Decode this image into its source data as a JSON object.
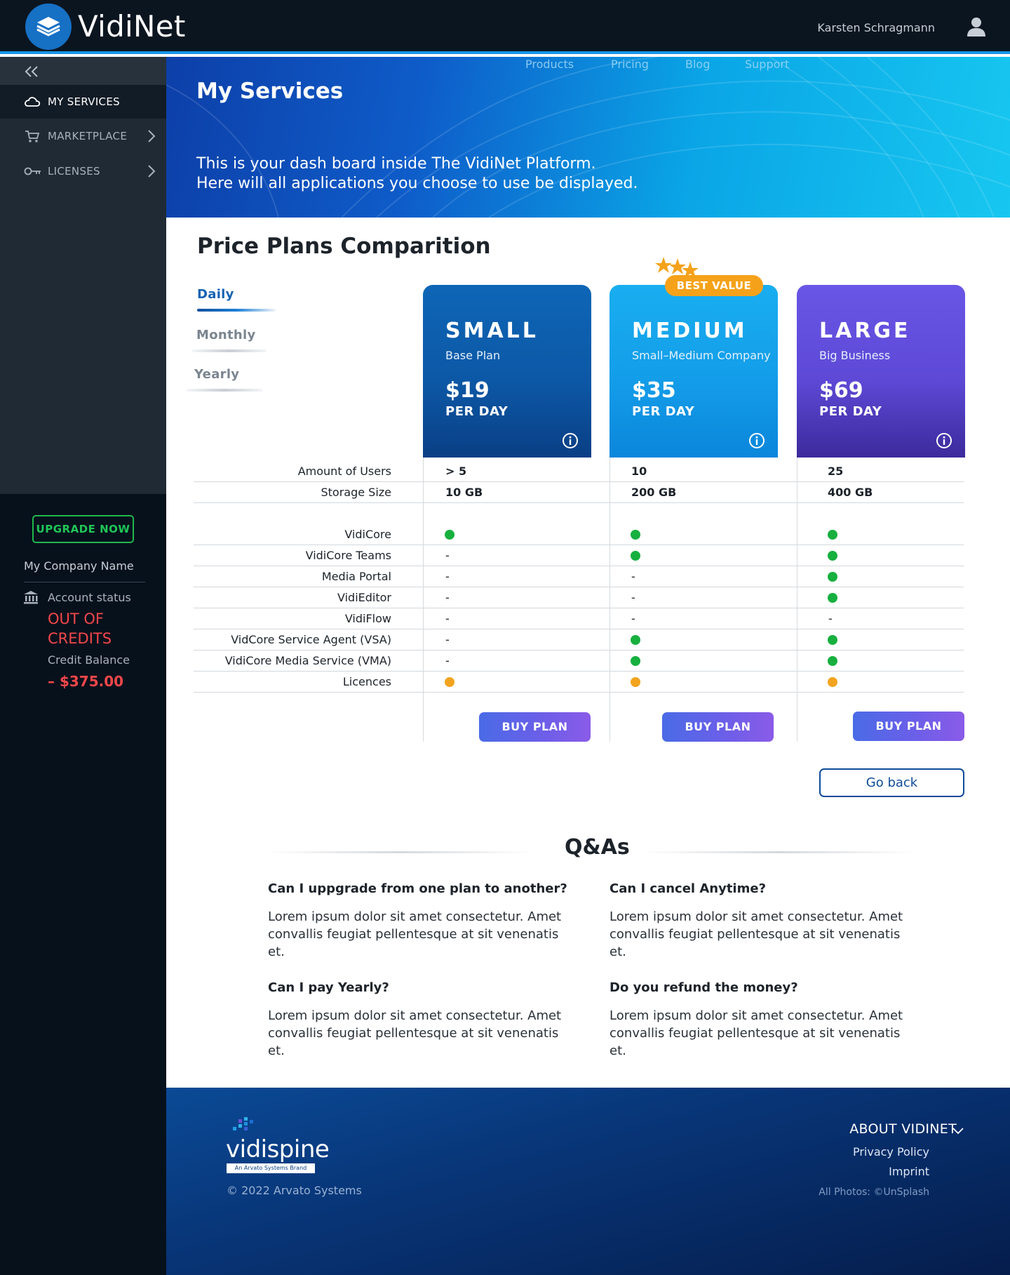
{
  "app": {
    "name": "VidiNet",
    "user_name": "Karsten Schragmann"
  },
  "sidebar": {
    "items": [
      {
        "label": "MY SERVICES",
        "icon": "cloud-icon",
        "active": true
      },
      {
        "label": "MARKETPLACE",
        "icon": "cart-icon"
      },
      {
        "label": "LICENSES",
        "icon": "key-icon"
      }
    ],
    "upgrade_label": "UPGRADE NOW",
    "company_name": "My Company Name",
    "account_status_label": "Account status",
    "account_status_value": "OUT OF CREDITS",
    "credit_balance_label": "Credit Balance",
    "credit_balance_value": "– $375.00"
  },
  "hero": {
    "nav": [
      "Products",
      "Pricing",
      "Blog",
      "Support"
    ],
    "title": "My Services",
    "subtitle_line1": "This is your dash board inside The VidiNet Platform.",
    "subtitle_line2": "Here will all applications you choose to use be displayed."
  },
  "pricing": {
    "title": "Price Plans Comparition",
    "periods": [
      "Daily",
      "Monthly",
      "Yearly"
    ],
    "active_period": "Daily",
    "best_value_label": "BEST VALUE",
    "plans": [
      {
        "name": "SMALL",
        "subtitle": "Base Plan",
        "price": "$19",
        "period": "PER DAY",
        "users": "> 5",
        "storage": "10 GB"
      },
      {
        "name": "MEDIUM",
        "subtitle": "Small–Medium Company",
        "price": "$35",
        "period": "PER DAY",
        "users": "10",
        "storage": "200 GB"
      },
      {
        "name": "LARGE",
        "subtitle": "Big Business",
        "price": "$69",
        "period": "PER DAY",
        "users": "25",
        "storage": "400 GB"
      }
    ],
    "row_labels": {
      "users": "Amount of Users",
      "storage": "Storage Size"
    },
    "features": [
      {
        "label": "VidiCore",
        "values": [
          "green",
          "green",
          "green"
        ]
      },
      {
        "label": "VidiCore Teams",
        "values": [
          "-",
          "green",
          "green"
        ]
      },
      {
        "label": "Media Portal",
        "values": [
          "-",
          "-",
          "green"
        ]
      },
      {
        "label": "VidiEditor",
        "values": [
          "-",
          "-",
          "green"
        ]
      },
      {
        "label": "VidiFlow",
        "values": [
          "-",
          "-",
          "-"
        ]
      },
      {
        "label": "VidCore Service Agent (VSA)",
        "values": [
          "-",
          "green",
          "green"
        ]
      },
      {
        "label": "VidiCore Media Service (VMA)",
        "values": [
          "-",
          "green",
          "green"
        ]
      },
      {
        "label": "Licences",
        "values": [
          "orange",
          "orange",
          "orange"
        ]
      }
    ],
    "buy_label": "BUY PLAN",
    "go_back_label": "Go back"
  },
  "qa": {
    "title": "Q&As",
    "items": [
      {
        "q": "Can I uppgrade from one plan to another?",
        "a": "Lorem ipsum dolor sit amet consectetur. Amet convallis feugiat pellentesque at sit venenatis et."
      },
      {
        "q": "Can I cancel Anytime?",
        "a": "Lorem ipsum dolor sit amet consectetur. Amet convallis feugiat pellentesque at sit venenatis et."
      },
      {
        "q": "Can I pay Yearly?",
        "a": "Lorem ipsum dolor sit amet consectetur. Amet convallis feugiat pellentesque at sit venenatis et."
      },
      {
        "q": "Do you refund the money?",
        "a": "Lorem ipsum dolor sit amet consectetur. Amet convallis feugiat pellentesque at sit venenatis et."
      }
    ]
  },
  "footer": {
    "brand": "vidispine",
    "brand_tag": "An Arvato Systems Brand",
    "copyright": "© 2022 Arvato Systems",
    "about": "ABOUT VIDINET",
    "links": [
      "Privacy Policy",
      "Imprint"
    ],
    "photos": "All Photos:  ©UnSplash"
  },
  "colors": {
    "accent": "#1793e6",
    "success": "#17b03f",
    "warning": "#f3a41f",
    "danger": "#f4474a",
    "brand_dark": "#0b1520"
  }
}
